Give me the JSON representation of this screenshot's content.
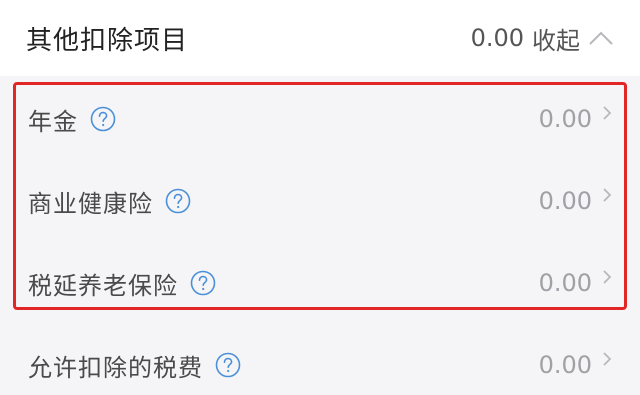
{
  "header": {
    "title": "其他扣除项目",
    "amount": "0.00",
    "collapse_label": "收起"
  },
  "items": [
    {
      "label": "年金",
      "value": "0.00"
    },
    {
      "label": "商业健康险",
      "value": "0.00"
    },
    {
      "label": "税延养老保险",
      "value": "0.00"
    },
    {
      "label": "允许扣除的税费",
      "value": "0.00"
    }
  ],
  "colors": {
    "highlight": "#e12626",
    "help_icon": "#4a90d9"
  }
}
